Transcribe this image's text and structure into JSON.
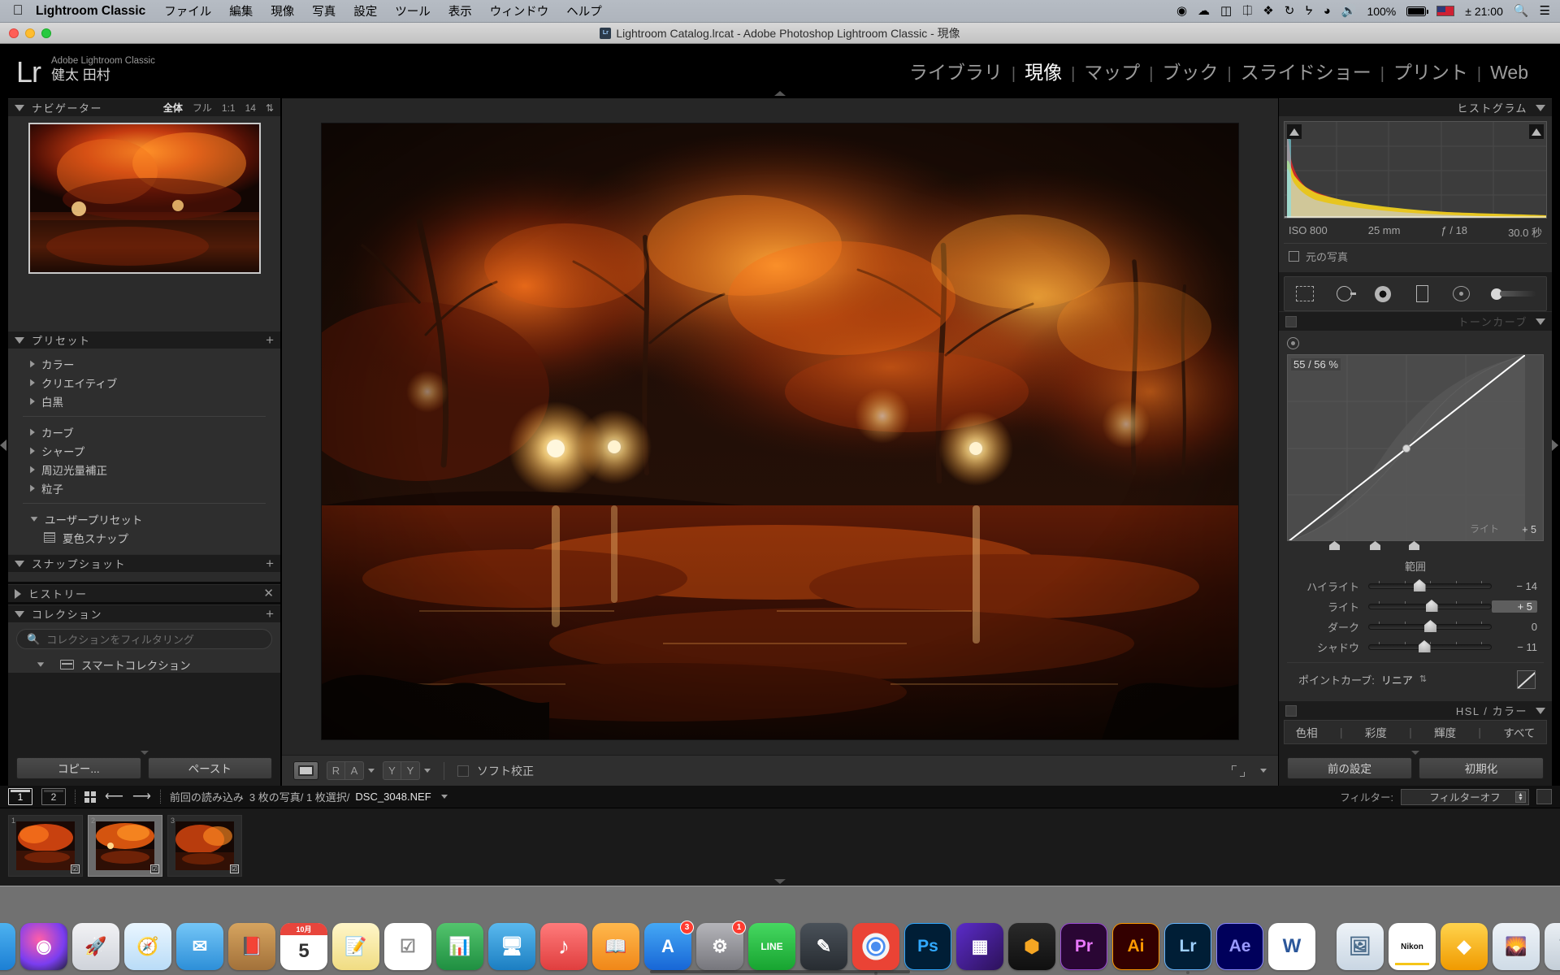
{
  "menubar": {
    "apple_icon": "apple-logo",
    "app_name": "Lightroom Classic",
    "items": [
      "ファイル",
      "編集",
      "現像",
      "写真",
      "設定",
      "ツール",
      "表示",
      "ウィンドウ",
      "ヘルプ"
    ],
    "status_icons": [
      "record-icon",
      "cloud-icon",
      "backup-icon",
      "html5-icon",
      "dropbox-icon",
      "timemachine-icon",
      "bluetooth-icon",
      "wifi-icon",
      "volume-icon"
    ],
    "battery_percent": "100%",
    "input_source": "us-flag",
    "time": "± 21:00",
    "search_icon": "search-icon",
    "control_center_icon": "menu-icon"
  },
  "titlebar": {
    "title": "Lightroom Catalog.lrcat - Adobe Photoshop Lightroom Classic - 現像",
    "file_icon": "lrcat-icon"
  },
  "identity": {
    "logo_mark": "Lr",
    "product": "Adobe Lightroom Classic",
    "user": "健太 田村"
  },
  "modules": [
    {
      "label": "ライブラリ",
      "active": false
    },
    {
      "label": "現像",
      "active": true
    },
    {
      "label": "マップ",
      "active": false
    },
    {
      "label": "ブック",
      "active": false
    },
    {
      "label": "スライドショー",
      "active": false
    },
    {
      "label": "プリント",
      "active": false
    },
    {
      "label": "Web",
      "active": false
    }
  ],
  "left_panel": {
    "navigator": {
      "title": "ナビゲーター",
      "zoom_options": [
        "全体",
        "フル",
        "1:1",
        "14"
      ],
      "active_zoom": "全体"
    },
    "presets": {
      "title": "プリセット",
      "add_icon": "plus-icon",
      "groups_a": [
        "カラー",
        "クリエイティブ",
        "白黒"
      ],
      "groups_b": [
        "カーブ",
        "シャープ",
        "周辺光量補正",
        "粒子"
      ],
      "user_group": "ユーザープリセット",
      "user_items": [
        "夏色スナップ"
      ]
    },
    "snapshots": {
      "title": "スナップショット",
      "add_icon": "plus-icon"
    },
    "history": {
      "title": "ヒストリー",
      "clear_icon": "close-icon"
    },
    "collections": {
      "title": "コレクション",
      "add_icon": "plus-icon",
      "filter_placeholder": "コレクションをフィルタリング",
      "items": [
        "スマートコレクション"
      ]
    },
    "footer": {
      "copy": "コピー...",
      "paste": "ペースト"
    }
  },
  "toolbar": {
    "view_icon": "loupe-view-icon",
    "before_after_left": "R",
    "before_after_right": "A",
    "flag_left": "Y",
    "flag_right": "Y",
    "softproof_label": "ソフト校正",
    "fit_icon": "fit-icon",
    "chevron_icon": "chevron-down-icon"
  },
  "right_panel": {
    "histogram": {
      "title": "ヒストグラム",
      "shadow_clip_icon": "shadow-clipping-icon",
      "highlight_clip_icon": "highlight-clipping-icon",
      "iso": "ISO 800",
      "focal": "25 mm",
      "aperture": "ƒ / 18",
      "shutter": "30.0 秒",
      "original_label": "元の写真"
    },
    "tools": [
      "crop-icon",
      "spot-removal-icon",
      "red-eye-icon",
      "graduated-filter-icon",
      "radial-filter-icon",
      "adjustment-brush-icon"
    ],
    "tone_curve": {
      "title": "トーンカーブ",
      "target_icon": "target-adjust-icon",
      "readout": "55 / 56 %",
      "hover_label": "ライト",
      "hover_value": "+ 5",
      "range_label": "範囲",
      "sliders": [
        {
          "name": "ハイライト",
          "value": "− 14",
          "pos": 41,
          "highlighted": false
        },
        {
          "name": "ライト",
          "value": "+ 5",
          "pos": 51,
          "highlighted": true
        },
        {
          "name": "ダーク",
          "value": "0",
          "pos": 50,
          "highlighted": false
        },
        {
          "name": "シャドウ",
          "value": "− 11",
          "pos": 45,
          "highlighted": false
        }
      ],
      "point_curve_label": "ポイントカーブ:",
      "point_curve_value": "リニア",
      "edit_icon": "curve-edit-icon"
    },
    "hsl": {
      "title": "HSL / カラー",
      "tabs": [
        "色相",
        "彩度",
        "輝度",
        "すべて"
      ]
    },
    "footer": {
      "previous": "前の設定",
      "reset": "初期化"
    }
  },
  "filmstrip": {
    "screen_buttons": [
      "1",
      "2"
    ],
    "grid_icon": "grid-view-icon",
    "back_icon": "arrow-left-icon",
    "forward_icon": "arrow-right-icon",
    "source": "前回の読み込み",
    "count": "3 枚の写真/ 1 枚選択/",
    "filename": "DSC_3048.NEF",
    "filename_caret": "chevron-down-icon",
    "filter_label": "フィルター:",
    "filter_value": "フィルターオフ",
    "thumbnails": [
      {
        "number": "1",
        "badge": "☑",
        "selected": false
      },
      {
        "number": "2",
        "badge": "☑",
        "selected": true
      },
      {
        "number": "3",
        "badge": "☑",
        "selected": false
      }
    ]
  },
  "dock": {
    "apps": [
      {
        "name": "finder-icon",
        "glyph": "☺",
        "color": "#3b9bdd"
      },
      {
        "name": "siri-icon",
        "glyph": "◉",
        "color": "#2b2b3a"
      },
      {
        "name": "launchpad-icon",
        "glyph": "🚀",
        "color": "#d9d9de"
      },
      {
        "name": "safari-icon",
        "glyph": "🧭",
        "color": "#eaf4fb"
      },
      {
        "name": "mail-icon",
        "glyph": "✉",
        "color": "#4fa8e8"
      },
      {
        "name": "contacts-icon",
        "glyph": "📕",
        "color": "#c38a4e"
      },
      {
        "name": "calendar-icon",
        "glyph": "5",
        "color": "#ffffff",
        "sub": "10月"
      },
      {
        "name": "notes-icon",
        "glyph": "📝",
        "color": "#fde68a"
      },
      {
        "name": "reminders-icon",
        "glyph": "☑",
        "color": "#ffffff"
      },
      {
        "name": "numbers-icon",
        "glyph": "📊",
        "color": "#3ba85a"
      },
      {
        "name": "keynote-icon",
        "glyph": "🖥",
        "color": "#3a9fd8"
      },
      {
        "name": "itunes-icon",
        "glyph": "♪",
        "color": "#f15a5a"
      },
      {
        "name": "ibooks-icon",
        "glyph": "📖",
        "color": "#f6a23c"
      },
      {
        "name": "appstore-icon",
        "glyph": "A",
        "color": "#2a8cf0",
        "badge": "3"
      },
      {
        "name": "settings-icon",
        "glyph": "⚙",
        "color": "#8e8e93",
        "badge": "1"
      },
      {
        "name": "line-icon",
        "glyph": "LINE",
        "color": "#2ec84a"
      },
      {
        "name": "skitch-icon",
        "glyph": "✎",
        "color": "#3a3f44"
      },
      {
        "name": "chrome-icon",
        "glyph": "◉",
        "color": "#f5f5f5"
      },
      {
        "name": "photoshop-icon",
        "glyph": "Ps",
        "color": "#001e36",
        "text": "#31a8ff"
      },
      {
        "name": "dimension-icon",
        "glyph": "▦",
        "color": "#2d1b4e"
      },
      {
        "name": "blender-icon",
        "glyph": "⬢",
        "color": "#1b1b1b"
      },
      {
        "name": "premiere-icon",
        "glyph": "Pr",
        "color": "#2a0634",
        "text": "#ea77ff"
      },
      {
        "name": "illustrator-icon",
        "glyph": "Ai",
        "color": "#330000",
        "text": "#ff9a00"
      },
      {
        "name": "lightroom-icon",
        "glyph": "Lr",
        "color": "#001e36",
        "text": "#9fd0ff",
        "running": true
      },
      {
        "name": "aftereffects-icon",
        "glyph": "Ae",
        "color": "#00005b",
        "text": "#9a9aff"
      },
      {
        "name": "word-icon",
        "glyph": "W",
        "color": "#ffffff",
        "text": "#2b579a"
      },
      {
        "name": "preview-icon",
        "glyph": "🖼",
        "color": "#dfe7ef"
      },
      {
        "name": "nikon-icon",
        "glyph": "Nikon",
        "color": "#ffffff",
        "text": "#111"
      },
      {
        "name": "sketch-icon",
        "glyph": "◆",
        "color": "#f7b500"
      },
      {
        "name": "photos-icon",
        "glyph": "🌄",
        "color": "#dfe7ef"
      },
      {
        "name": "trash-icon",
        "glyph": "🗑",
        "color": "#d7dde4"
      }
    ]
  }
}
